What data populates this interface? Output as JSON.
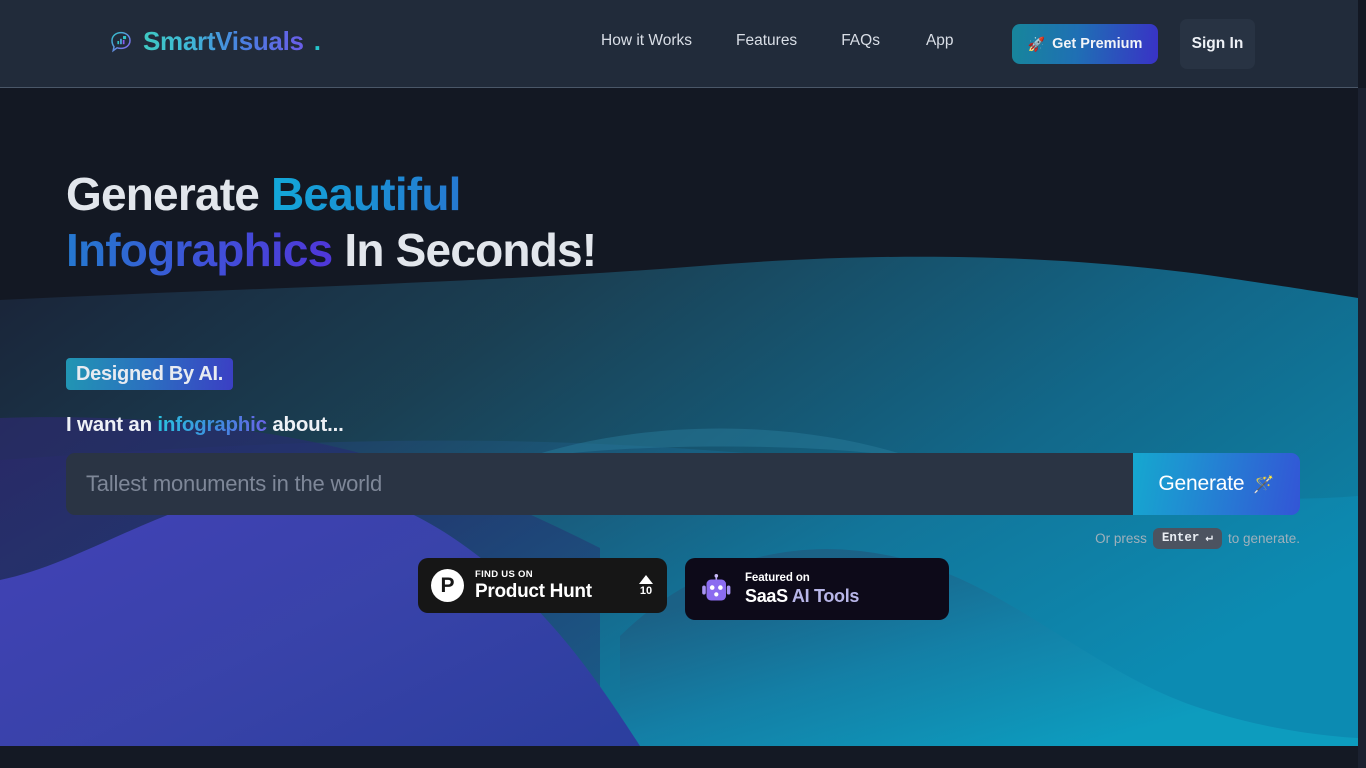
{
  "brand": {
    "name": "SmartVisuals",
    "dot": ".",
    "icon": "chat-bubble-chart-icon"
  },
  "header": {
    "nav": [
      {
        "label": "How it Works"
      },
      {
        "label": "Features"
      },
      {
        "label": "FAQs"
      },
      {
        "label": "App"
      }
    ],
    "premium_button": {
      "label": "Get Premium",
      "icon": "rocket-icon"
    },
    "signin_button": {
      "label": "Sign In"
    }
  },
  "hero": {
    "headline": {
      "part1": "Generate ",
      "gradient1": "Beautiful Infographics",
      "part2": " In Seconds!"
    },
    "ai_badge": "Designed By AI.",
    "prompt_label": {
      "before": "I want an ",
      "highlight": "infographic",
      "after": " about..."
    },
    "prompt_input": {
      "value": "",
      "placeholder": "Tallest monuments in the world",
      "caret": "|"
    },
    "generate_button": {
      "label": "Generate",
      "icon": "magic-wand-icon"
    },
    "enter_hint": {
      "before": "Or press",
      "key": "Enter",
      "key_symbol": "↵",
      "after": "to generate."
    }
  },
  "badges": {
    "product_hunt": {
      "kicker": "FIND US ON",
      "name": "Product Hunt",
      "logo_letter": "P",
      "upvote_icon": "triangle-up-icon",
      "upvote_count": "10"
    },
    "saas_ai_tools": {
      "kicker": "Featured on",
      "name_part1": "SaaS",
      "name_part2": " AI Tools",
      "icon": "robot-icon"
    }
  },
  "colors": {
    "page_bg": "#131823",
    "header_bg": "#212b3a",
    "accent_cyan": "#15a8cf",
    "accent_blue": "#3355d6",
    "accent_violet": "#5036d8",
    "accent_teal": "#25c6cd",
    "input_bg": "#2a3444",
    "wave_teal_dark": "#1d4355",
    "wave_teal": "#12698f",
    "wave_teal_light": "#0f8fb5",
    "wave_indigo": "#2a2a6e",
    "wave_blue": "#3a47b0",
    "bottom_bar": "#141924"
  }
}
